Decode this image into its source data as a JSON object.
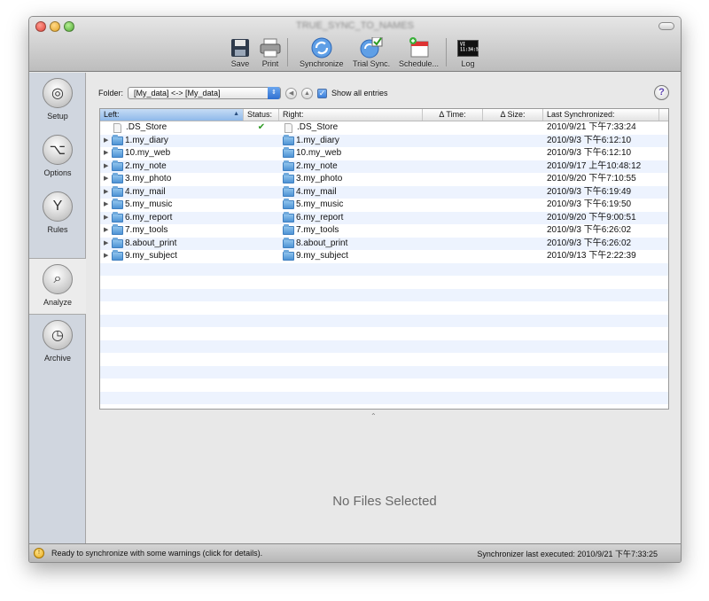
{
  "window": {
    "title": "TRUE_SYNC_TO_NAMES"
  },
  "toolbar": {
    "save": "Save",
    "print": "Print",
    "synchronize": "Synchronize",
    "trial_sync": "Trial Sync.",
    "schedule": "Schedule...",
    "log": "Log",
    "log_screen": "VI\n11:34:5"
  },
  "sidebar": {
    "items": [
      {
        "label": "Setup",
        "icon": "target-icon"
      },
      {
        "label": "Options",
        "icon": "option-key-icon"
      },
      {
        "label": "Rules",
        "icon": "fork-icon"
      },
      {
        "label": "Analyze",
        "icon": "magnifier-icon"
      },
      {
        "label": "Archive",
        "icon": "clock-icon"
      }
    ],
    "active": "Analyze"
  },
  "folder": {
    "label": "Folder:",
    "value": "[My_data] <-> [My_data]",
    "show_all_label": "Show all entries",
    "show_all_checked": true
  },
  "table": {
    "headers": {
      "left": "Left:",
      "status": "Status:",
      "right": "Right:",
      "time": "Δ Time:",
      "size": "Δ Size:",
      "last": "Last Synchronized:"
    },
    "rows": [
      {
        "left": ".DS_Store",
        "status": "✔",
        "right": ".DS_Store",
        "last": "2010/9/21 下午7:33:24",
        "type": "file"
      },
      {
        "left": "1.my_diary",
        "status": "",
        "right": "1.my_diary",
        "last": "2010/9/3 下午6:12:10",
        "type": "folder"
      },
      {
        "left": "10.my_web",
        "status": "",
        "right": "10.my_web",
        "last": "2010/9/3 下午6:12:10",
        "type": "folder"
      },
      {
        "left": "2.my_note",
        "status": "",
        "right": "2.my_note",
        "last": "2010/9/17 上午10:48:12",
        "type": "folder"
      },
      {
        "left": "3.my_photo",
        "status": "",
        "right": "3.my_photo",
        "last": "2010/9/20 下午7:10:55",
        "type": "folder"
      },
      {
        "left": "4.my_mail",
        "status": "",
        "right": "4.my_mail",
        "last": "2010/9/3 下午6:19:49",
        "type": "folder"
      },
      {
        "left": "5.my_music",
        "status": "",
        "right": "5.my_music",
        "last": "2010/9/3 下午6:19:50",
        "type": "folder"
      },
      {
        "left": "6.my_report",
        "status": "",
        "right": "6.my_report",
        "last": "2010/9/20 下午9:00:51",
        "type": "folder"
      },
      {
        "left": "7.my_tools",
        "status": "",
        "right": "7.my_tools",
        "last": "2010/9/3 下午6:26:02",
        "type": "folder"
      },
      {
        "left": "8.about_print",
        "status": "",
        "right": "8.about_print",
        "last": "2010/9/3 下午6:26:02",
        "type": "folder"
      },
      {
        "left": "9.my_subject",
        "status": "",
        "right": "9.my_subject",
        "last": "2010/9/13 下午2:22:39",
        "type": "folder"
      }
    ]
  },
  "detail": {
    "no_files": "No Files Selected"
  },
  "status": {
    "message": "Ready to synchronize with some warnings (click for details).",
    "last_executed": "Synchronizer last executed:  2010/9/21 下午7:33:25"
  }
}
